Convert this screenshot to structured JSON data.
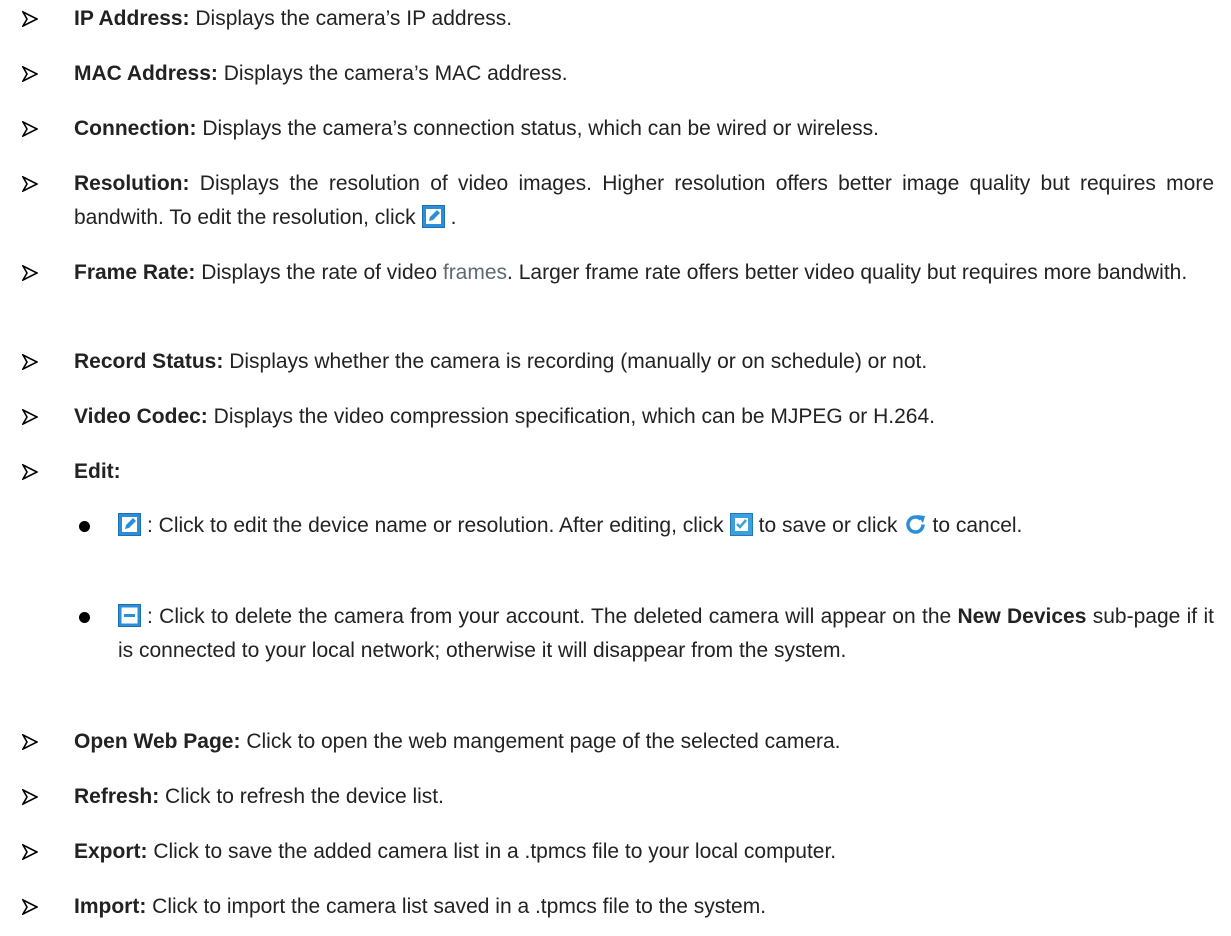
{
  "items": [
    {
      "label": "IP Address:",
      "text": " Displays the camera’s IP address."
    },
    {
      "label": "MAC Address:",
      "text": " Displays the camera’s MAC address."
    },
    {
      "label": "Connection:",
      "text": " Displays the camera’s connection status, which can be wired or wireless."
    },
    {
      "label": "Resolution:",
      "text": " Displays the resolution of video images. Higher resolution offers better image quality but requires more bandwith. To edit the resolution, click",
      "text_end": "."
    },
    {
      "label": "Frame Rate:",
      "text": " Displays the rate of video ",
      "muted": "frames",
      "text_end": ". Larger frame rate offers better video quality but requires more bandwith."
    },
    {
      "label": "Record Status:",
      "text": " Displays whether the camera is recording (manually or on schedule) or not."
    },
    {
      "label": "Video Codec:",
      "text": " Displays the video compression specification, which can be MJPEG or H.264."
    },
    {
      "label": "Edit:"
    },
    {
      "label": "Open Web Page:",
      "text": " Click to open the web mangement page of the selected camera."
    },
    {
      "label": "Refresh:",
      "text": " Click to refresh the device list."
    },
    {
      "label": "Export:",
      "text": " Click to save the added camera list in a .tpmcs file to your local computer."
    },
    {
      "label": "Import:",
      "text": " Click to import the camera list saved in a .tpmcs file to the system."
    }
  ],
  "edit_sub": [
    {
      "text_a": ": Click to edit the device name or resolution. After editing, click",
      "text_b": "to save or click",
      "text_c": "to cancel."
    },
    {
      "text_a": ": Click to delete the camera from your account. The deleted camera will appear on the",
      "bold": "New Devices",
      "text_b": "sub-page if it is connected to your local network; otherwise it will disappear from the system."
    }
  ],
  "icons": {
    "edit": "edit-icon",
    "save": "save-icon",
    "cancel": "refresh-cancel-icon",
    "delete": "delete-icon"
  },
  "colors": {
    "icon_blue": "#2a8fd8",
    "icon_green": "#3aa0e0",
    "muted_text": "#5c6a73"
  }
}
